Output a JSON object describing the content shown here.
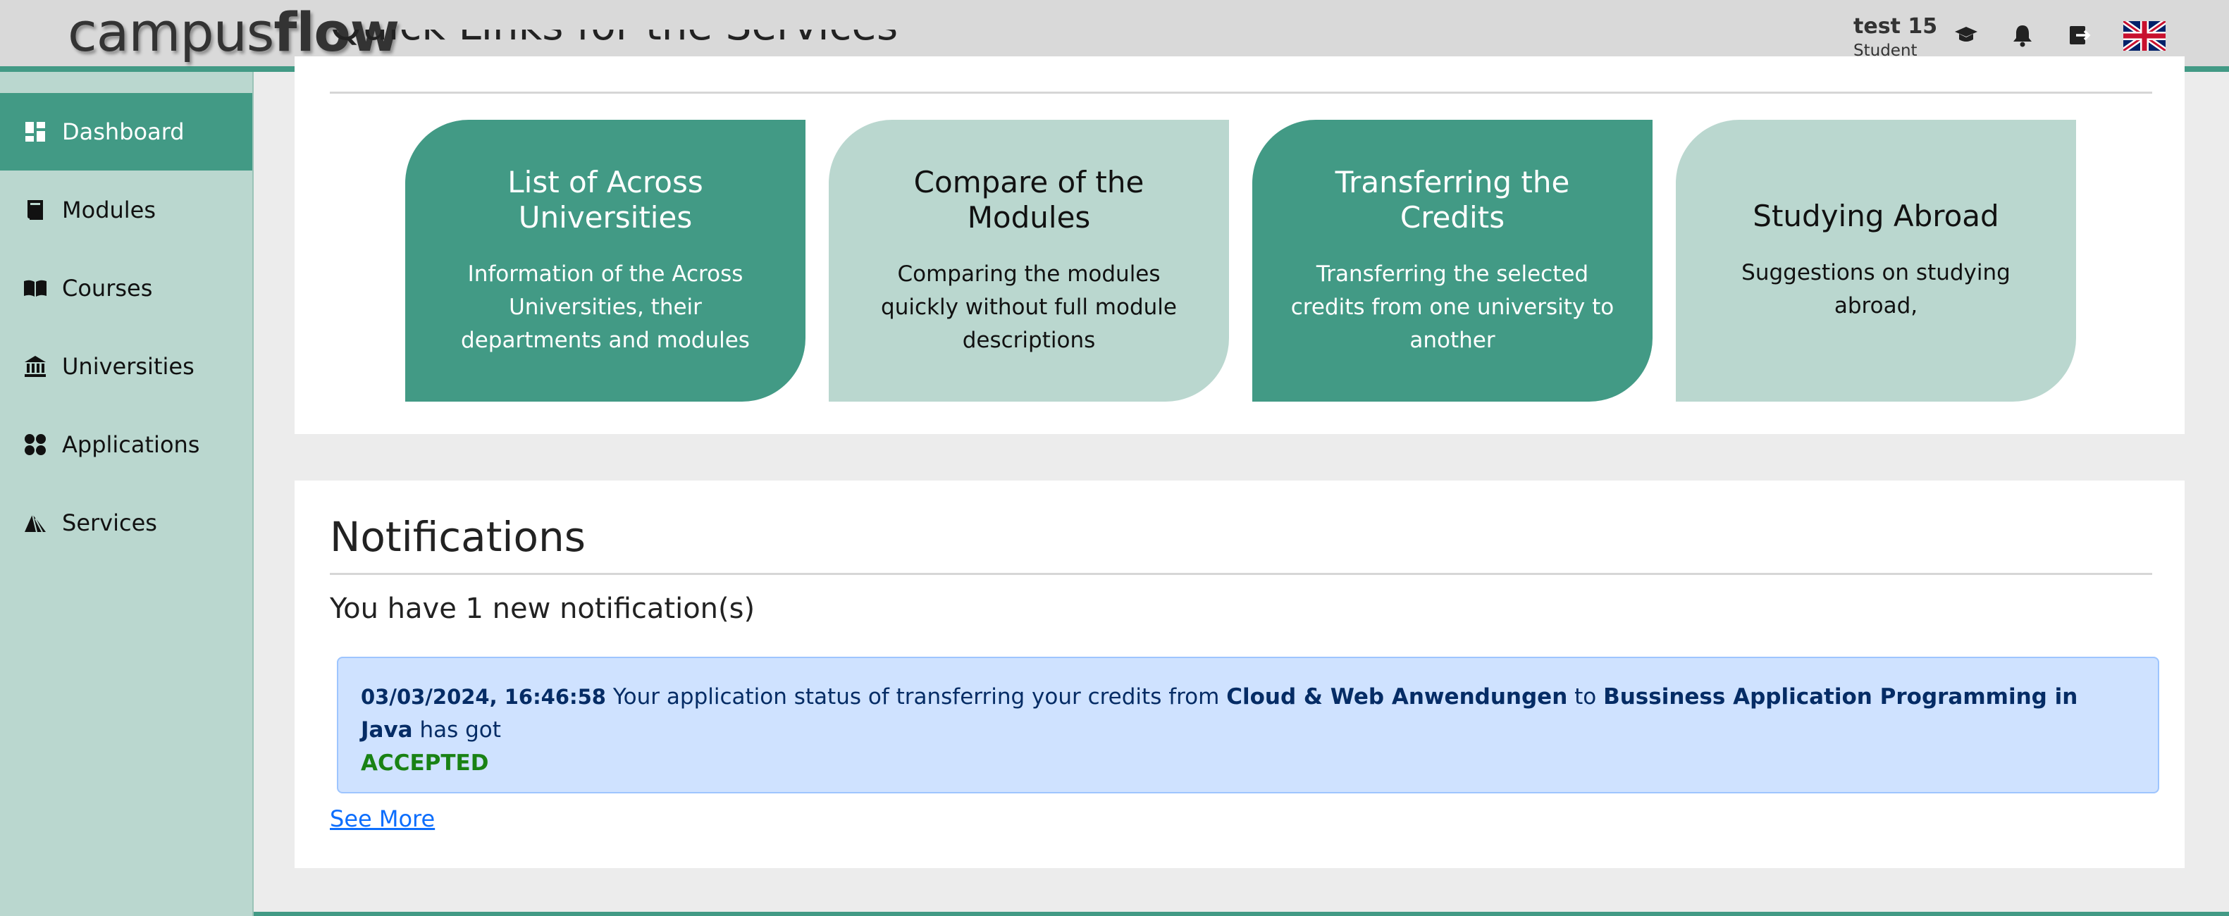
{
  "header": {
    "logo_light": "campus",
    "logo_bold": "flow",
    "user_name": "test 15",
    "user_role": "Student",
    "icons": [
      "graduation-cap-icon",
      "bell-icon",
      "logout-icon",
      "uk-flag-icon"
    ]
  },
  "sidebar": {
    "items": [
      {
        "label": "Dashboard",
        "icon": "dashboard-icon",
        "active": true
      },
      {
        "label": "Modules",
        "icon": "book-icon",
        "active": false
      },
      {
        "label": "Courses",
        "icon": "open-book-icon",
        "active": false
      },
      {
        "label": "Universities",
        "icon": "university-icon",
        "active": false
      },
      {
        "label": "Applications",
        "icon": "apps-icon",
        "active": false
      },
      {
        "label": "Services",
        "icon": "services-icon",
        "active": false
      }
    ]
  },
  "quick_links": {
    "title": "Quick Links for the Services",
    "cards": [
      {
        "title": "List of Across Universities",
        "description": "Information of the Across Universities, their departments and modules"
      },
      {
        "title": "Compare of the Modules",
        "description": "Comparing the modules quickly without full module descriptions"
      },
      {
        "title": "Transferring the Credits",
        "description": "Transferring the selected credits from one university to another"
      },
      {
        "title": "Studying Abroad",
        "description": "Suggestions on studying abroad,"
      }
    ]
  },
  "notifications": {
    "title": "Notifications",
    "count_text": "You have 1 new notification(s)",
    "items": [
      {
        "timestamp": "03/03/2024, 16:46:58",
        "text_before": "Your application status of transferring your credits from",
        "from_module": "Cloud & Web Anwendungen",
        "text_mid": "to",
        "to_module": "Bussiness Application Programming in Java",
        "text_after": "has got",
        "status": "ACCEPTED"
      }
    ],
    "see_more": "See More"
  },
  "colors": {
    "primary": "#429a85",
    "primary_light": "#bad7cf",
    "header_bg": "#d9d9d9",
    "notif_bg": "#cfe2ff",
    "accepted": "#198214",
    "link": "#0d6efd"
  }
}
